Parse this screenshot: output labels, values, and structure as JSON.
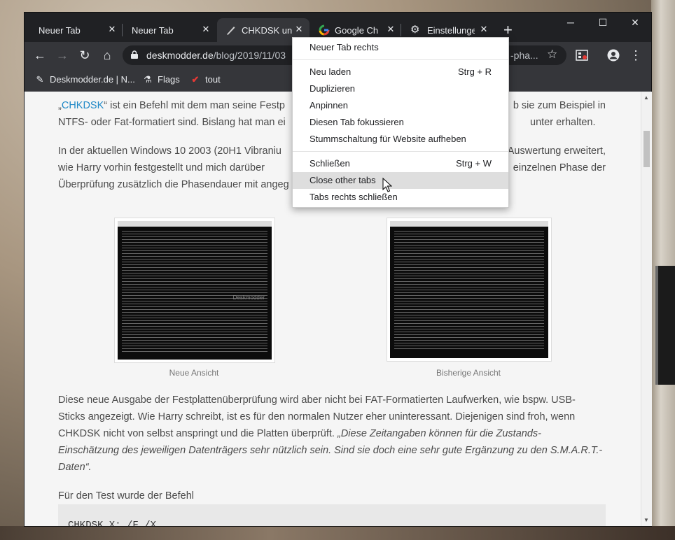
{
  "tabs": [
    {
      "title": "Neuer Tab",
      "active": false
    },
    {
      "title": "Neuer Tab",
      "active": false
    },
    {
      "title": "CHKDSK unt",
      "active": true,
      "favicon": "pen-icon"
    },
    {
      "title": "Google Chro",
      "active": false,
      "favicon": "google-icon"
    },
    {
      "title": "Einstellungen",
      "active": false,
      "favicon": "gear-icon"
    }
  ],
  "newtab_label": "+",
  "window_controls": {
    "minimize": "─",
    "maximize": "☐",
    "close": "✕"
  },
  "toolbar": {
    "back": "←",
    "forward": "→",
    "reload": "↻",
    "home": "⌂",
    "url_host": "deskmodder.de",
    "url_path": "/blog/2019/11/03",
    "url_tail": "-pha...",
    "star": "☆",
    "menu": "⋮"
  },
  "bookmarks": [
    {
      "label": "Deskmodder.de | N...",
      "icon": "pen-icon"
    },
    {
      "label": "Flags",
      "icon": "flask-icon"
    },
    {
      "label": "tout",
      "icon": "check-icon"
    }
  ],
  "article": {
    "p1_link": "CHKDSK",
    "p1_prefix": "„",
    "p1_line1_a": "“ ist ein Befehl mit dem man seine Festp",
    "p1_line1_b": "b sie zum Beispiel in",
    "p1_line2_a": "NTFS- oder Fat-formatiert sind. Bislang hat man ei",
    "p1_line2_b": "unter erhalten.",
    "p2_line1_a": "In der aktuellen Windows 10 2003 (20H1 Vibraniu",
    "p2_line1_b": "Auswertung erweitert,",
    "p2_line2_a": "wie Harry vorhin festgestellt und mich darüber",
    "p2_line2_b": "einzelnen Phase der",
    "p2_line3": "Überprüfung zusätzlich die Phasendauer mit angeg",
    "fig1_caption": "Neue Ansicht",
    "fig2_caption": "Bisherige Ansicht",
    "watermark": "Deskmodder",
    "p3_line1": "Diese neue Ausgabe der Festplattenüberprüfung wird aber nicht bei FAT-Formatierten Laufwerken, wie bspw. USB-",
    "p3_line2": "Sticks angezeigt. Wie Harry schreibt, ist es für den normalen Nutzer eher uninteressant. Diejenigen sind froh, wenn",
    "p3_line3_a": "CHKDSK nicht von selbst anspringt und die Platten überprüft. ",
    "p3_line3_b": "„Diese Zeitangaben können für die Zustands-",
    "p3_line4": "Einschätzung des jeweiligen Datenträgers sehr nützlich sein. Sind sie doch eine sehr gute Ergänzung zu den S.M.A.R.T.-",
    "p3_line5": "Daten“.",
    "p4": "Für den Test wurde der Befehl",
    "code": "CHKDSK X: /F /X"
  },
  "context_menu": {
    "items": [
      {
        "label": "Neuer Tab rechts",
        "shortcut": ""
      },
      {
        "label": "Neu laden",
        "shortcut": "Strg + R"
      },
      {
        "label": "Duplizieren",
        "shortcut": ""
      },
      {
        "label": "Anpinnen",
        "shortcut": ""
      },
      {
        "label": "Diesen Tab fokussieren",
        "shortcut": ""
      },
      {
        "label": "Stummschaltung für Website aufheben",
        "shortcut": ""
      },
      {
        "label": "Schließen",
        "shortcut": "Strg + W"
      },
      {
        "label": "Close other tabs",
        "shortcut": "",
        "highlighted": true
      },
      {
        "label": "Tabs rechts schließen",
        "shortcut": ""
      }
    ]
  }
}
